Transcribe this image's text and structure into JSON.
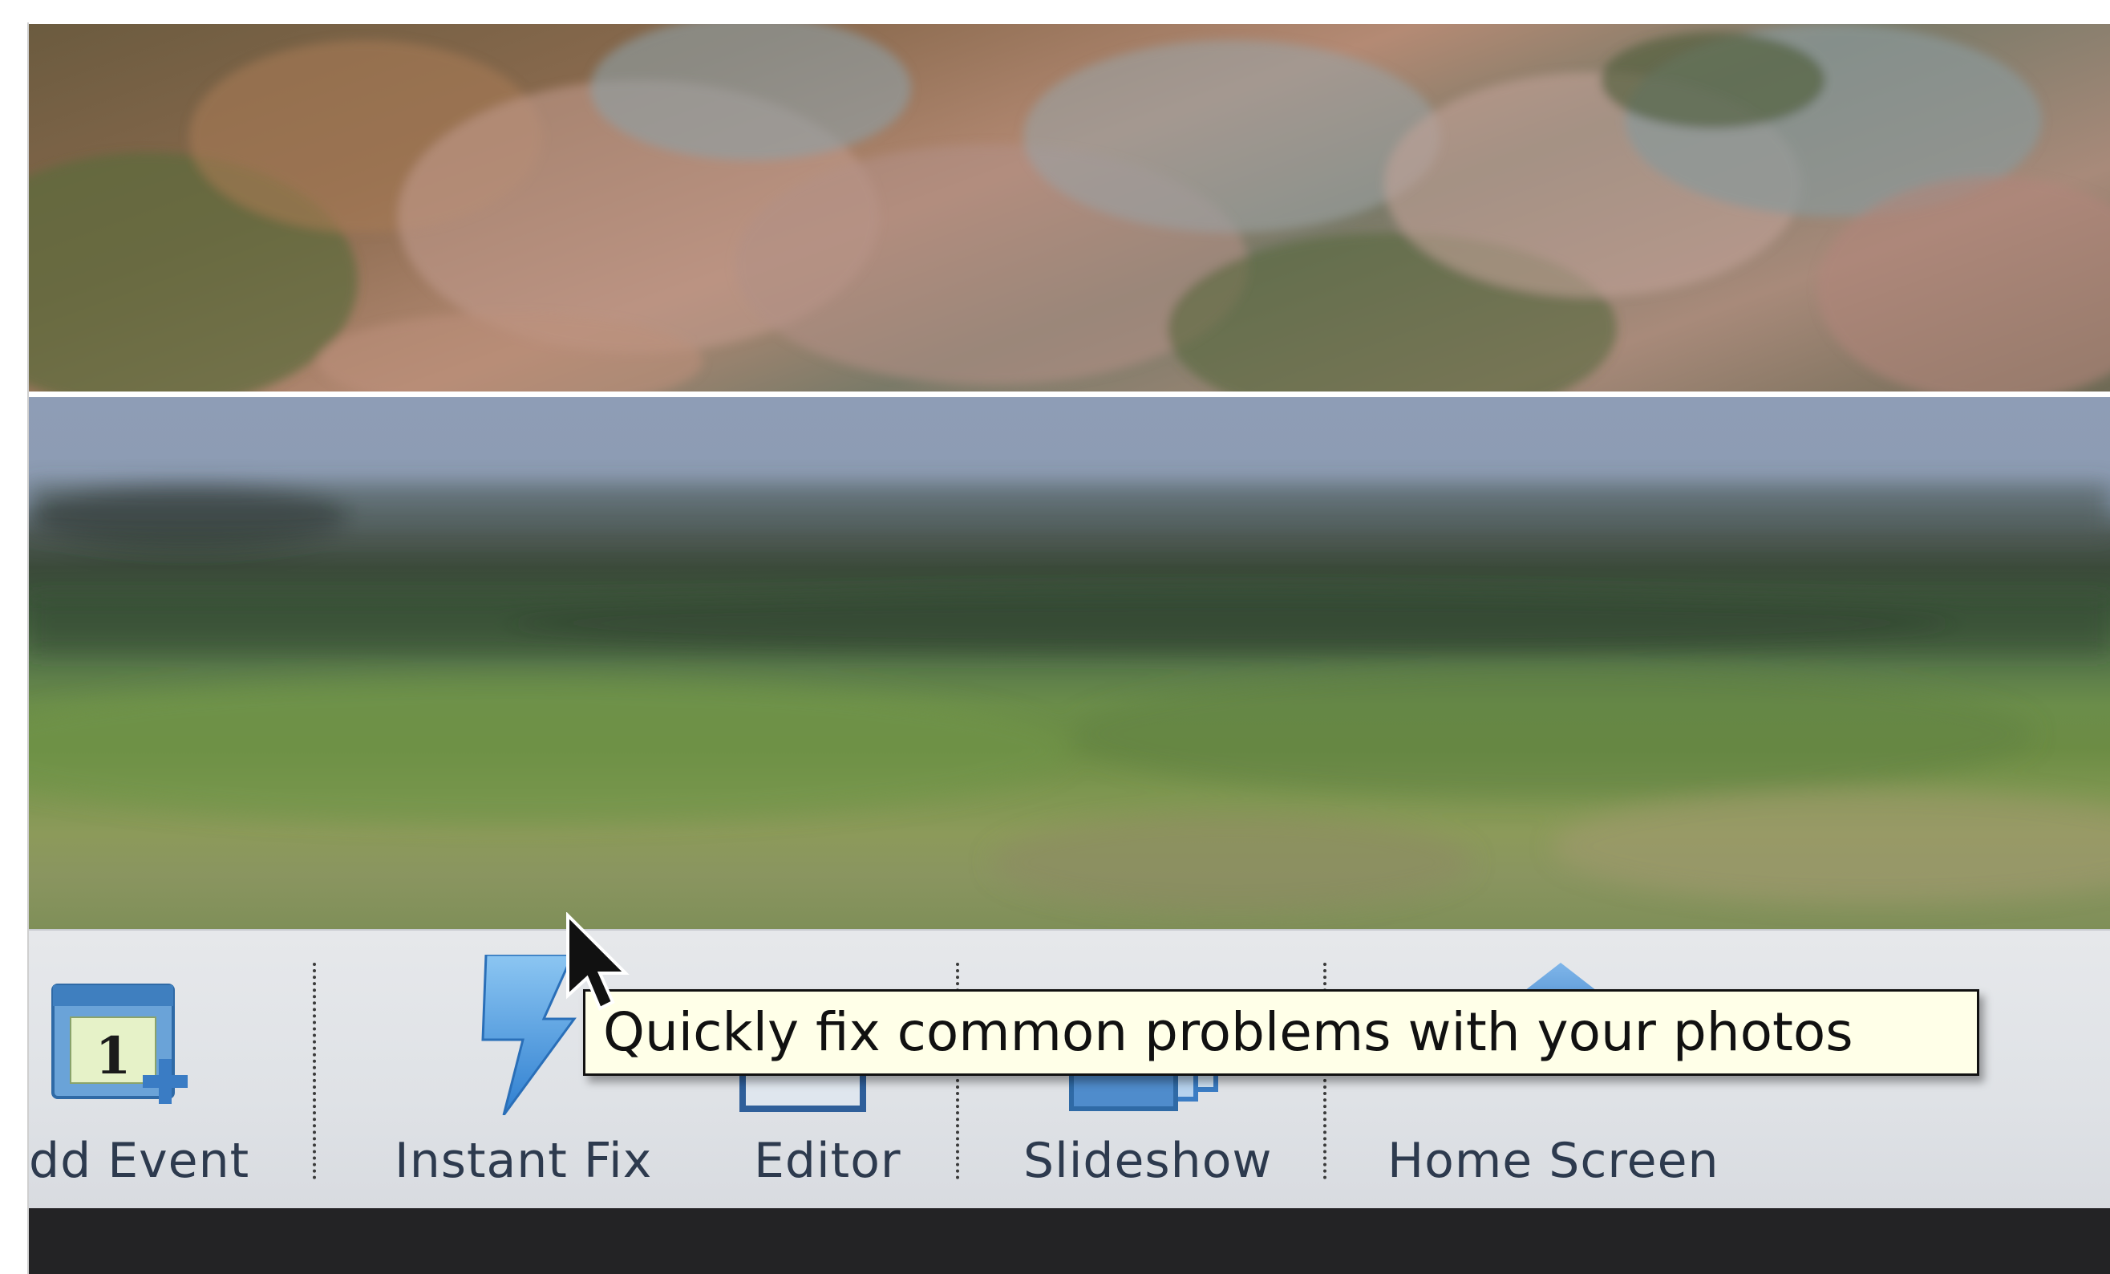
{
  "toolbar": {
    "items": [
      {
        "label": "dd Event",
        "icon": "calendar-add-icon"
      },
      {
        "label": "Instant Fix",
        "icon": "lightning-bolt-icon"
      },
      {
        "label": "Editor",
        "icon": "editor-photo-icon"
      },
      {
        "label": "Slideshow",
        "icon": "slideshow-stack-icon"
      },
      {
        "label": "Home Screen",
        "icon": "home-arrow-icon"
      }
    ],
    "calendar_day": "1"
  },
  "tooltip": {
    "text": "Quickly fix common problems with your photos"
  },
  "colors": {
    "toolbar_bg": "#e0e3e7",
    "label_text": "#2d3a4e",
    "icon_blue": "#3a7cc4",
    "tooltip_bg": "#ffffe8"
  }
}
